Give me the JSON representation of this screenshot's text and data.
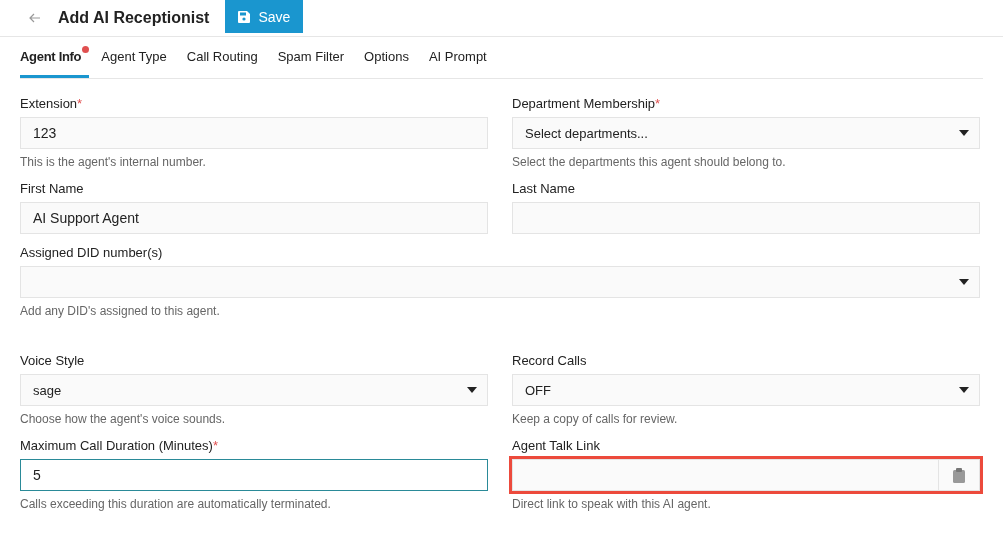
{
  "header": {
    "title": "Add AI Receptionist",
    "save_button": "Save"
  },
  "tabs": [
    {
      "label": "Agent Info",
      "selected": true,
      "alert": true
    },
    {
      "label": "Agent Type",
      "selected": false,
      "alert": false
    },
    {
      "label": "Call Routing",
      "selected": false,
      "alert": false
    },
    {
      "label": "Spam Filter",
      "selected": false,
      "alert": false
    },
    {
      "label": "Options",
      "selected": false,
      "alert": false
    },
    {
      "label": "AI Prompt",
      "selected": false,
      "alert": false
    }
  ],
  "form_rows": [
    {
      "fields": [
        {
          "kind": "text",
          "label": "Extension",
          "required_mark": "*",
          "value": "123",
          "help": "This is the agent's internal number.",
          "focused": false,
          "highlighted": false
        },
        {
          "kind": "select",
          "label": "Department Membership",
          "required_mark": "*",
          "placeholder": "Select departments...",
          "help": "Select the departments this agent should belong to.",
          "focused": false,
          "highlighted": false
        }
      ]
    },
    {
      "fields": [
        {
          "kind": "text",
          "label": "First Name",
          "value": "AI Support Agent",
          "focused": false,
          "highlighted": false
        },
        {
          "kind": "text",
          "label": "Last Name",
          "focused": false,
          "highlighted": false
        }
      ]
    },
    {
      "fields": [
        {
          "kind": "select",
          "label": "Assigned DID number(s)",
          "help": "Add any DID's assigned to this agent.",
          "focused": false,
          "highlighted": false
        }
      ]
    },
    {
      "fields": [
        {
          "kind": "select",
          "label": "Voice Style",
          "value": "sage",
          "help": "Choose how the agent's voice sounds.",
          "focused": false,
          "highlighted": false
        },
        {
          "kind": "select",
          "label": "Record Calls",
          "value": "OFF",
          "help": "Keep a copy of calls for review.",
          "focused": false,
          "highlighted": false
        }
      ]
    },
    {
      "fields": [
        {
          "kind": "text",
          "label": "Maximum Call Duration (Minutes)",
          "required_mark": "*",
          "value": "5",
          "help": "Calls exceeding this duration are automatically terminated.",
          "focused": true,
          "highlighted": false
        },
        {
          "kind": "link",
          "label": "Agent Talk Link",
          "help": "Direct link to speak with this AI agent.",
          "focused": false,
          "highlighted": true
        }
      ]
    }
  ]
}
